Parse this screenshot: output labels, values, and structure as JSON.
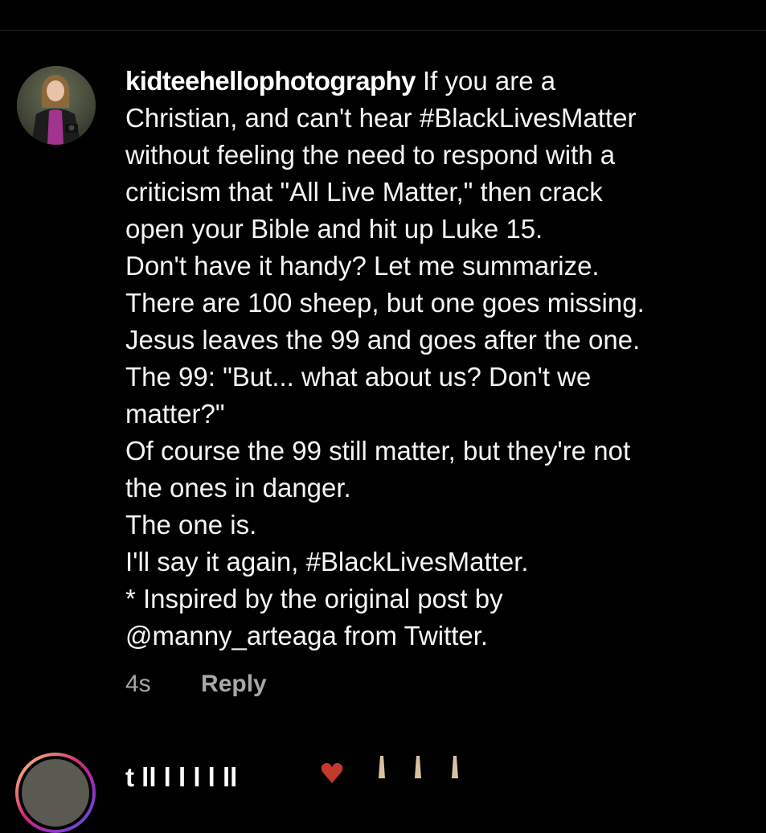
{
  "comment": {
    "username": "kidteehellophotography",
    "lines": [
      "If you are a",
      "Christian, and can't hear #BlackLivesMatter",
      "without feeling the need to respond with a",
      "criticism that \"All Live Matter,\" then crack",
      "open your Bible and hit up Luke 15.",
      "Don't have it handy?  Let me summarize.",
      "There are 100 sheep, but one goes missing.",
      "Jesus leaves the 99 and goes after the one.",
      "The 99: \"But... what about us? Don't we",
      "matter?\"",
      "Of course the 99 still matter, but they're not",
      "the ones in danger.",
      "The one is.",
      "I'll say it again, #BlackLivesMatter.",
      "* Inspired by the original post by",
      "@manny_arteaga from Twitter."
    ],
    "time": "4s",
    "reply_label": "Reply"
  },
  "next_comment": {
    "username_partial": "t     ll  l      l  l   l  ll",
    "icons": [
      "heart-icon",
      "clap-icon",
      "clap-icon",
      "clap-icon"
    ]
  },
  "colors": {
    "background": "#000000",
    "primary_text": "#f5f5f5",
    "secondary_text": "#a8a8a8",
    "divider": "#262626",
    "heart": "#c0392b",
    "clap": "#d9c2a3"
  }
}
